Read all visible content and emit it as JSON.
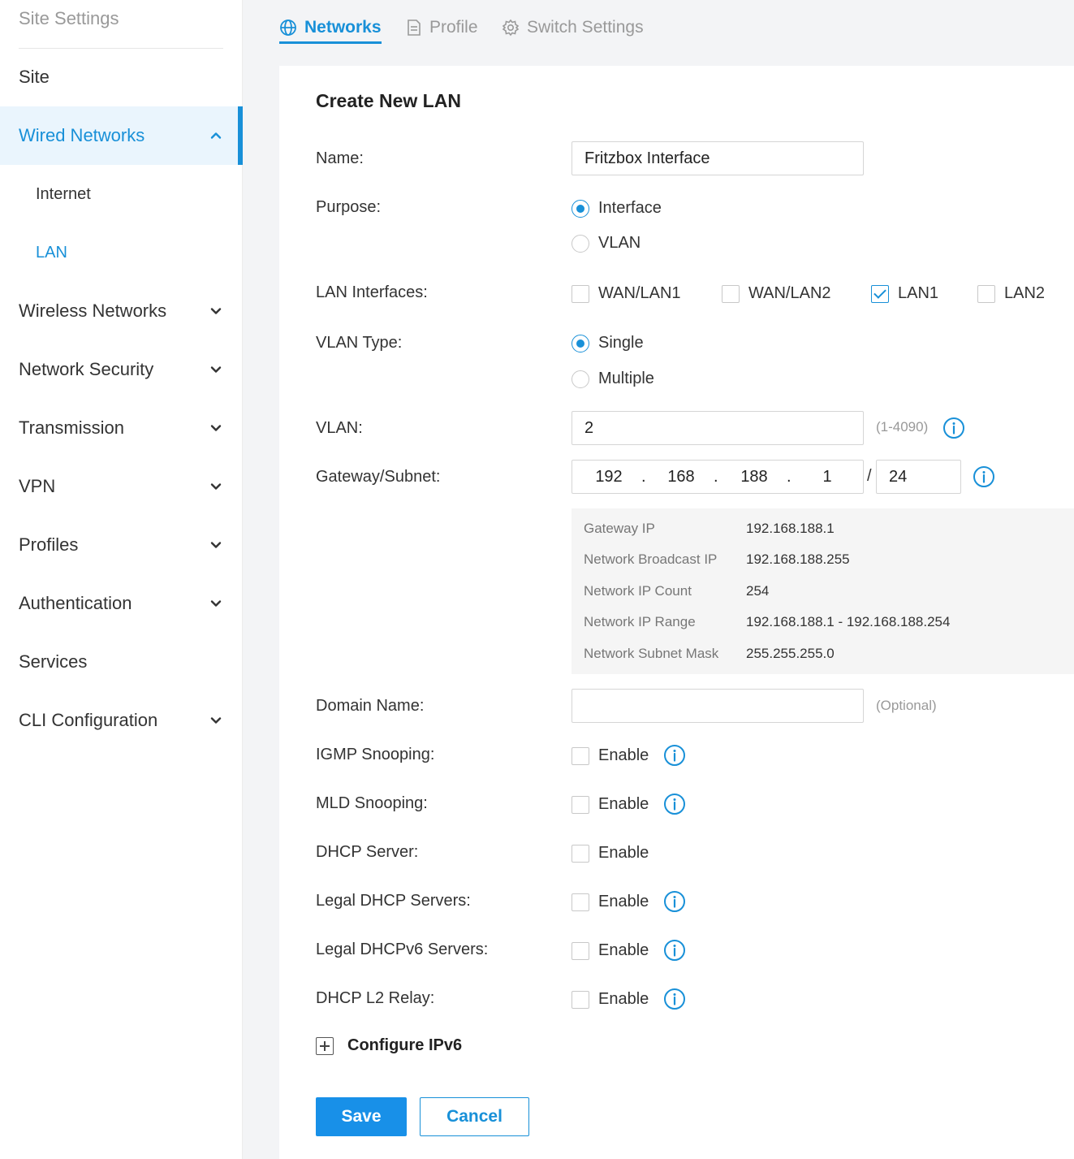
{
  "sidebar": {
    "header": "Site Settings",
    "items": [
      {
        "label": "Site"
      },
      {
        "label": "Wired Networks"
      },
      {
        "label": "Internet"
      },
      {
        "label": "LAN"
      },
      {
        "label": "Wireless Networks"
      },
      {
        "label": "Network Security"
      },
      {
        "label": "Transmission"
      },
      {
        "label": "VPN"
      },
      {
        "label": "Profiles"
      },
      {
        "label": "Authentication"
      },
      {
        "label": "Services"
      },
      {
        "label": "CLI Configuration"
      }
    ]
  },
  "tabs": [
    {
      "label": "Networks",
      "icon": "globe-icon"
    },
    {
      "label": "Profile",
      "icon": "document-icon"
    },
    {
      "label": "Switch Settings",
      "icon": "gear-icon"
    }
  ],
  "form": {
    "title": "Create New LAN",
    "name": {
      "label": "Name:",
      "value": "Fritzbox Interface"
    },
    "purpose": {
      "label": "Purpose:",
      "options": [
        "Interface",
        "VLAN"
      ],
      "selected": "Interface"
    },
    "lan_interfaces": {
      "label": "LAN Interfaces:",
      "options": [
        "WAN/LAN1",
        "WAN/LAN2",
        "LAN1",
        "LAN2"
      ],
      "checked": [
        "LAN1"
      ]
    },
    "vlan_type": {
      "label": "VLAN Type:",
      "options": [
        "Single",
        "Multiple"
      ],
      "selected": "Single"
    },
    "vlan": {
      "label": "VLAN:",
      "value": "2",
      "hint": "(1-4090)"
    },
    "gateway": {
      "label": "Gateway/Subnet:",
      "octets": [
        "192",
        "168",
        "188",
        "1"
      ],
      "dot": ".",
      "slash": "/",
      "mask": "24"
    },
    "summary": {
      "gateway_ip_label": "Gateway IP",
      "gateway_ip": "192.168.188.1",
      "broadcast_label": "Network Broadcast IP",
      "broadcast": "192.168.188.255",
      "count_label": "Network IP Count",
      "count": "254",
      "range_label": "Network IP Range",
      "range": "192.168.188.1 - 192.168.188.254",
      "mask_label": "Network Subnet Mask",
      "mask": "255.255.255.0"
    },
    "domain": {
      "label": "Domain Name:",
      "value": "",
      "hint": "(Optional)"
    },
    "enable_text": "Enable",
    "toggles": [
      {
        "label": "IGMP Snooping:"
      },
      {
        "label": "MLD Snooping:"
      },
      {
        "label": "DHCP Server:"
      },
      {
        "label": "Legal DHCP Servers:"
      },
      {
        "label": "Legal DHCPv6 Servers:"
      },
      {
        "label": "DHCP L2 Relay:"
      }
    ],
    "ipv6_label": "Configure IPv6",
    "save_label": "Save",
    "cancel_label": "Cancel"
  },
  "colors": {
    "accent": "#1890d8",
    "active_bg": "#eaf5fd"
  }
}
